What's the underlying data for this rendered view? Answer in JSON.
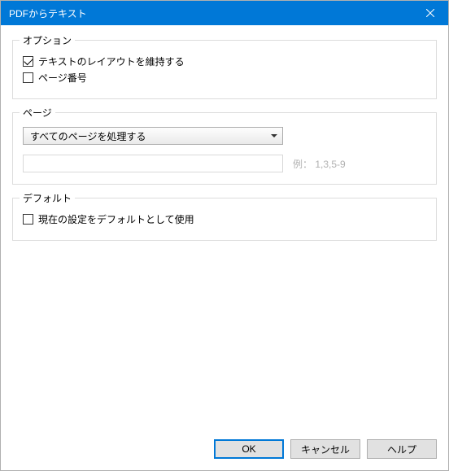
{
  "window": {
    "title": "PDFからテキスト"
  },
  "options": {
    "legend": "オプション",
    "retain_layout": {
      "label": "テキストのレイアウトを維持する",
      "checked": true
    },
    "page_numbers": {
      "label": "ページ番号",
      "checked": false
    }
  },
  "pages": {
    "legend": "ページ",
    "select_value": "すべてのページを処理する",
    "range_value": "",
    "example_label": "例： 1,3,5-9"
  },
  "defaults": {
    "legend": "デフォルト",
    "use_as_default": {
      "label": "現在の設定をデフォルトとして使用",
      "checked": false
    }
  },
  "buttons": {
    "ok": "OK",
    "cancel": "キャンセル",
    "help": "ヘルプ"
  }
}
